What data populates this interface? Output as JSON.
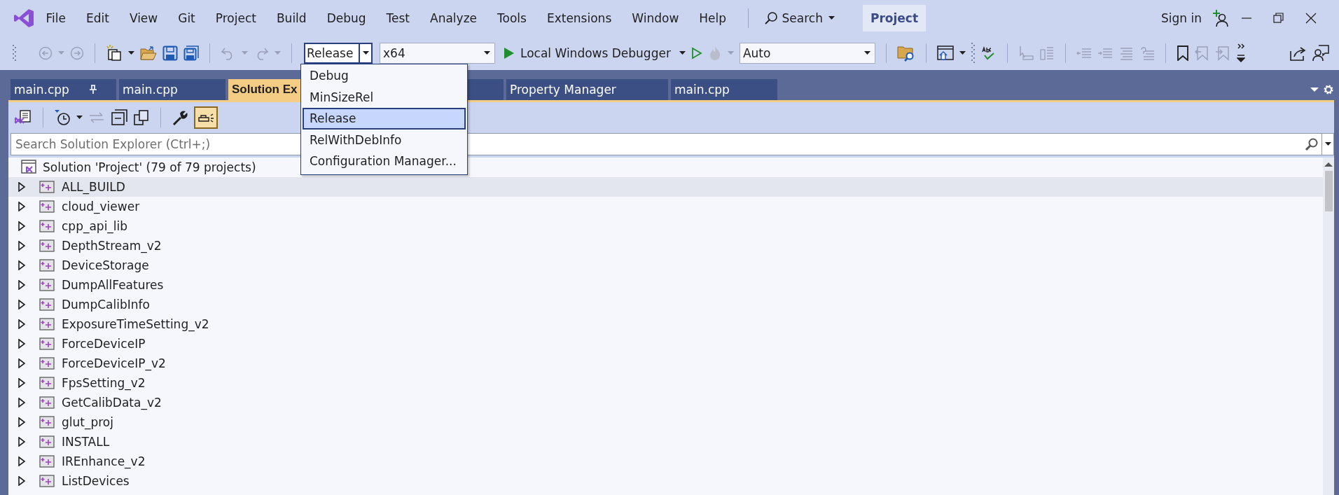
{
  "menu": {
    "items": [
      "File",
      "Edit",
      "View",
      "Git",
      "Project",
      "Build",
      "Debug",
      "Test",
      "Analyze",
      "Tools",
      "Extensions",
      "Window",
      "Help"
    ]
  },
  "search": {
    "label": "Search"
  },
  "solution_name": "Project",
  "sign_in": "Sign in",
  "toolbar": {
    "configuration": {
      "value": "Release",
      "expanded": true
    },
    "platform": {
      "value": "x64"
    },
    "debugger": {
      "label": "Local Windows Debugger"
    },
    "auto": {
      "value": "Auto"
    }
  },
  "configuration_dropdown": [
    {
      "label": "Debug",
      "selected": false
    },
    {
      "label": "MinSizeRel",
      "selected": false
    },
    {
      "label": "Release",
      "selected": true
    },
    {
      "label": "RelWithDebInfo",
      "selected": false
    },
    {
      "label": "Configuration Manager...",
      "selected": false
    }
  ],
  "tabs": [
    {
      "label": "main.cpp",
      "pinned": true,
      "selected": false
    },
    {
      "label": "main.cpp",
      "pinned": false,
      "selected": false
    },
    {
      "label": "Solution Ex",
      "pinned": false,
      "selected": true
    },
    {
      "pinned": false,
      "selected": false
    },
    {
      "label": "Property Manager",
      "pinned": false,
      "selected": false
    },
    {
      "label": "main.cpp",
      "pinned": false,
      "selected": false
    }
  ],
  "solution_explorer": {
    "preview_on": true,
    "search": {
      "placeholder": "Search Solution Explorer (Ctrl+;)"
    },
    "solution": "Solution 'Project' (79 of 79 projects)",
    "projects": [
      {
        "name": "ALL_BUILD",
        "expanded": false,
        "selected": true
      },
      {
        "name": "cloud_viewer",
        "expanded": false,
        "selected": false
      },
      {
        "name": "cpp_api_lib",
        "expanded": false,
        "selected": false
      },
      {
        "name": "DepthStream_v2",
        "expanded": false,
        "selected": false
      },
      {
        "name": "DeviceStorage",
        "expanded": false,
        "selected": false
      },
      {
        "name": "DumpAllFeatures",
        "expanded": false,
        "selected": false
      },
      {
        "name": "DumpCalibInfo",
        "expanded": false,
        "selected": false
      },
      {
        "name": "ExposureTimeSetting_v2",
        "expanded": false,
        "selected": false
      },
      {
        "name": "ForceDeviceIP",
        "expanded": false,
        "selected": false
      },
      {
        "name": "ForceDeviceIP_v2",
        "expanded": false,
        "selected": false
      },
      {
        "name": "FpsSetting_v2",
        "expanded": false,
        "selected": false
      },
      {
        "name": "GetCalibData_v2",
        "expanded": false,
        "selected": false
      },
      {
        "name": "glut_proj",
        "expanded": false,
        "selected": false
      },
      {
        "name": "INSTALL",
        "expanded": false,
        "selected": false
      },
      {
        "name": "IREnhance_v2",
        "expanded": false,
        "selected": false
      },
      {
        "name": "ListDevices",
        "expanded": false,
        "selected": false
      }
    ]
  }
}
